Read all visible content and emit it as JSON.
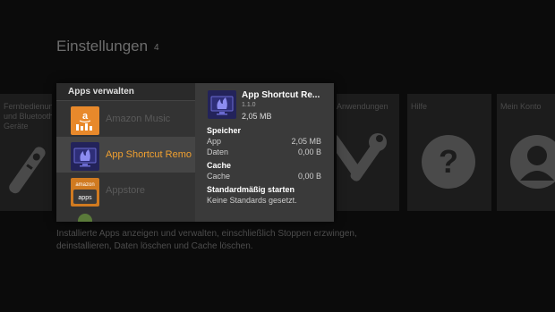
{
  "page": {
    "title": "Einstellungen",
    "count": "4"
  },
  "tiles": [
    {
      "label": "Fernbedienungen und Bluetooth-Geräte",
      "icon": "remote-icon"
    },
    {
      "label": "Anwendungen",
      "icon": "wrench-icon"
    },
    {
      "label": "Hilfe",
      "icon": "help-icon"
    },
    {
      "label": "Mein Konto",
      "icon": "account-icon"
    }
  ],
  "description": "Installierte Apps anzeigen und verwalten, einschließlich Stoppen erzwingen, deinstallieren, Daten löschen und Cache löschen.",
  "panel": {
    "header": "Apps verwalten",
    "apps": [
      {
        "name": "Amazon Music",
        "icon": "amazon-music-icon"
      },
      {
        "name": "App Shortcut Remo",
        "icon": "app-shortcut-icon",
        "selected": true
      },
      {
        "name": "Appstore",
        "icon": "appstore-icon",
        "icon_text": "amazon",
        "icon_sub": "apps"
      }
    ],
    "details": {
      "name": "App Shortcut Re...",
      "version": "1.1.0",
      "size": "2,05 MB",
      "storage": {
        "title": "Speicher",
        "rows": [
          {
            "label": "App",
            "value": "2,05 MB"
          },
          {
            "label": "Daten",
            "value": "0,00 B"
          }
        ]
      },
      "cache": {
        "title": "Cache",
        "label": "Cache",
        "value": "0,00 B"
      },
      "defaults": {
        "title": "Standardmäßig starten",
        "text": "Keine Standards gesetzt."
      }
    }
  }
}
